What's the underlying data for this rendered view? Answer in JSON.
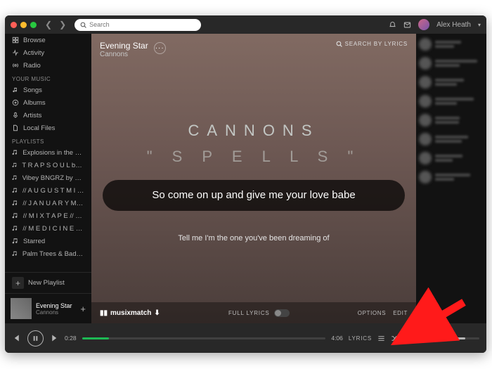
{
  "titlebar": {
    "dots": [
      "#ff5f57",
      "#febc2e",
      "#28c840"
    ],
    "search_placeholder": "Search",
    "user": "Alex Heath"
  },
  "sidebar": {
    "main": [
      {
        "label": "Browse",
        "icon": "browse"
      },
      {
        "label": "Activity",
        "icon": "activity"
      },
      {
        "label": "Radio",
        "icon": "radio"
      }
    ],
    "music_head": "YOUR MUSIC",
    "music": [
      {
        "label": "Songs",
        "icon": "note"
      },
      {
        "label": "Albums",
        "icon": "disc"
      },
      {
        "label": "Artists",
        "icon": "mic"
      },
      {
        "label": "Local Files",
        "icon": "file"
      }
    ],
    "pl_head": "PLAYLISTS",
    "playlists": [
      "Explosions in the Sk…",
      "T R A P S O U L by bry…",
      "Vibey BNGRZ by Jack…",
      "// A U G U S T M I X …",
      "// J A N U A R Y M I …",
      "// M I X T A P E // b…",
      "// M E D I C I N E // …",
      "Starred",
      "Palm Trees & Bad B*…"
    ],
    "new_playlist": "New Playlist"
  },
  "now_playing": {
    "title": "Evening Star",
    "artist": "Cannons"
  },
  "main": {
    "title": "Evening Star",
    "artist": "Cannons",
    "search_by_lyrics": "SEARCH BY LYRICS",
    "bg_line1": "CANNONS",
    "bg_line2": "\" S P E L L S \"",
    "lyric_current": "So come on up and give me your love babe",
    "lyric_next": "Tell me I'm the one you've been dreaming of",
    "musixmatch": "musixmatch",
    "full_lyrics": "FULL LYRICS",
    "options": "OPTIONS",
    "edit": "EDIT"
  },
  "player": {
    "elapsed": "0:28",
    "total": "4:06",
    "progress_pct": 11,
    "lyrics_label": "LYRICS"
  },
  "friends_count": 8
}
